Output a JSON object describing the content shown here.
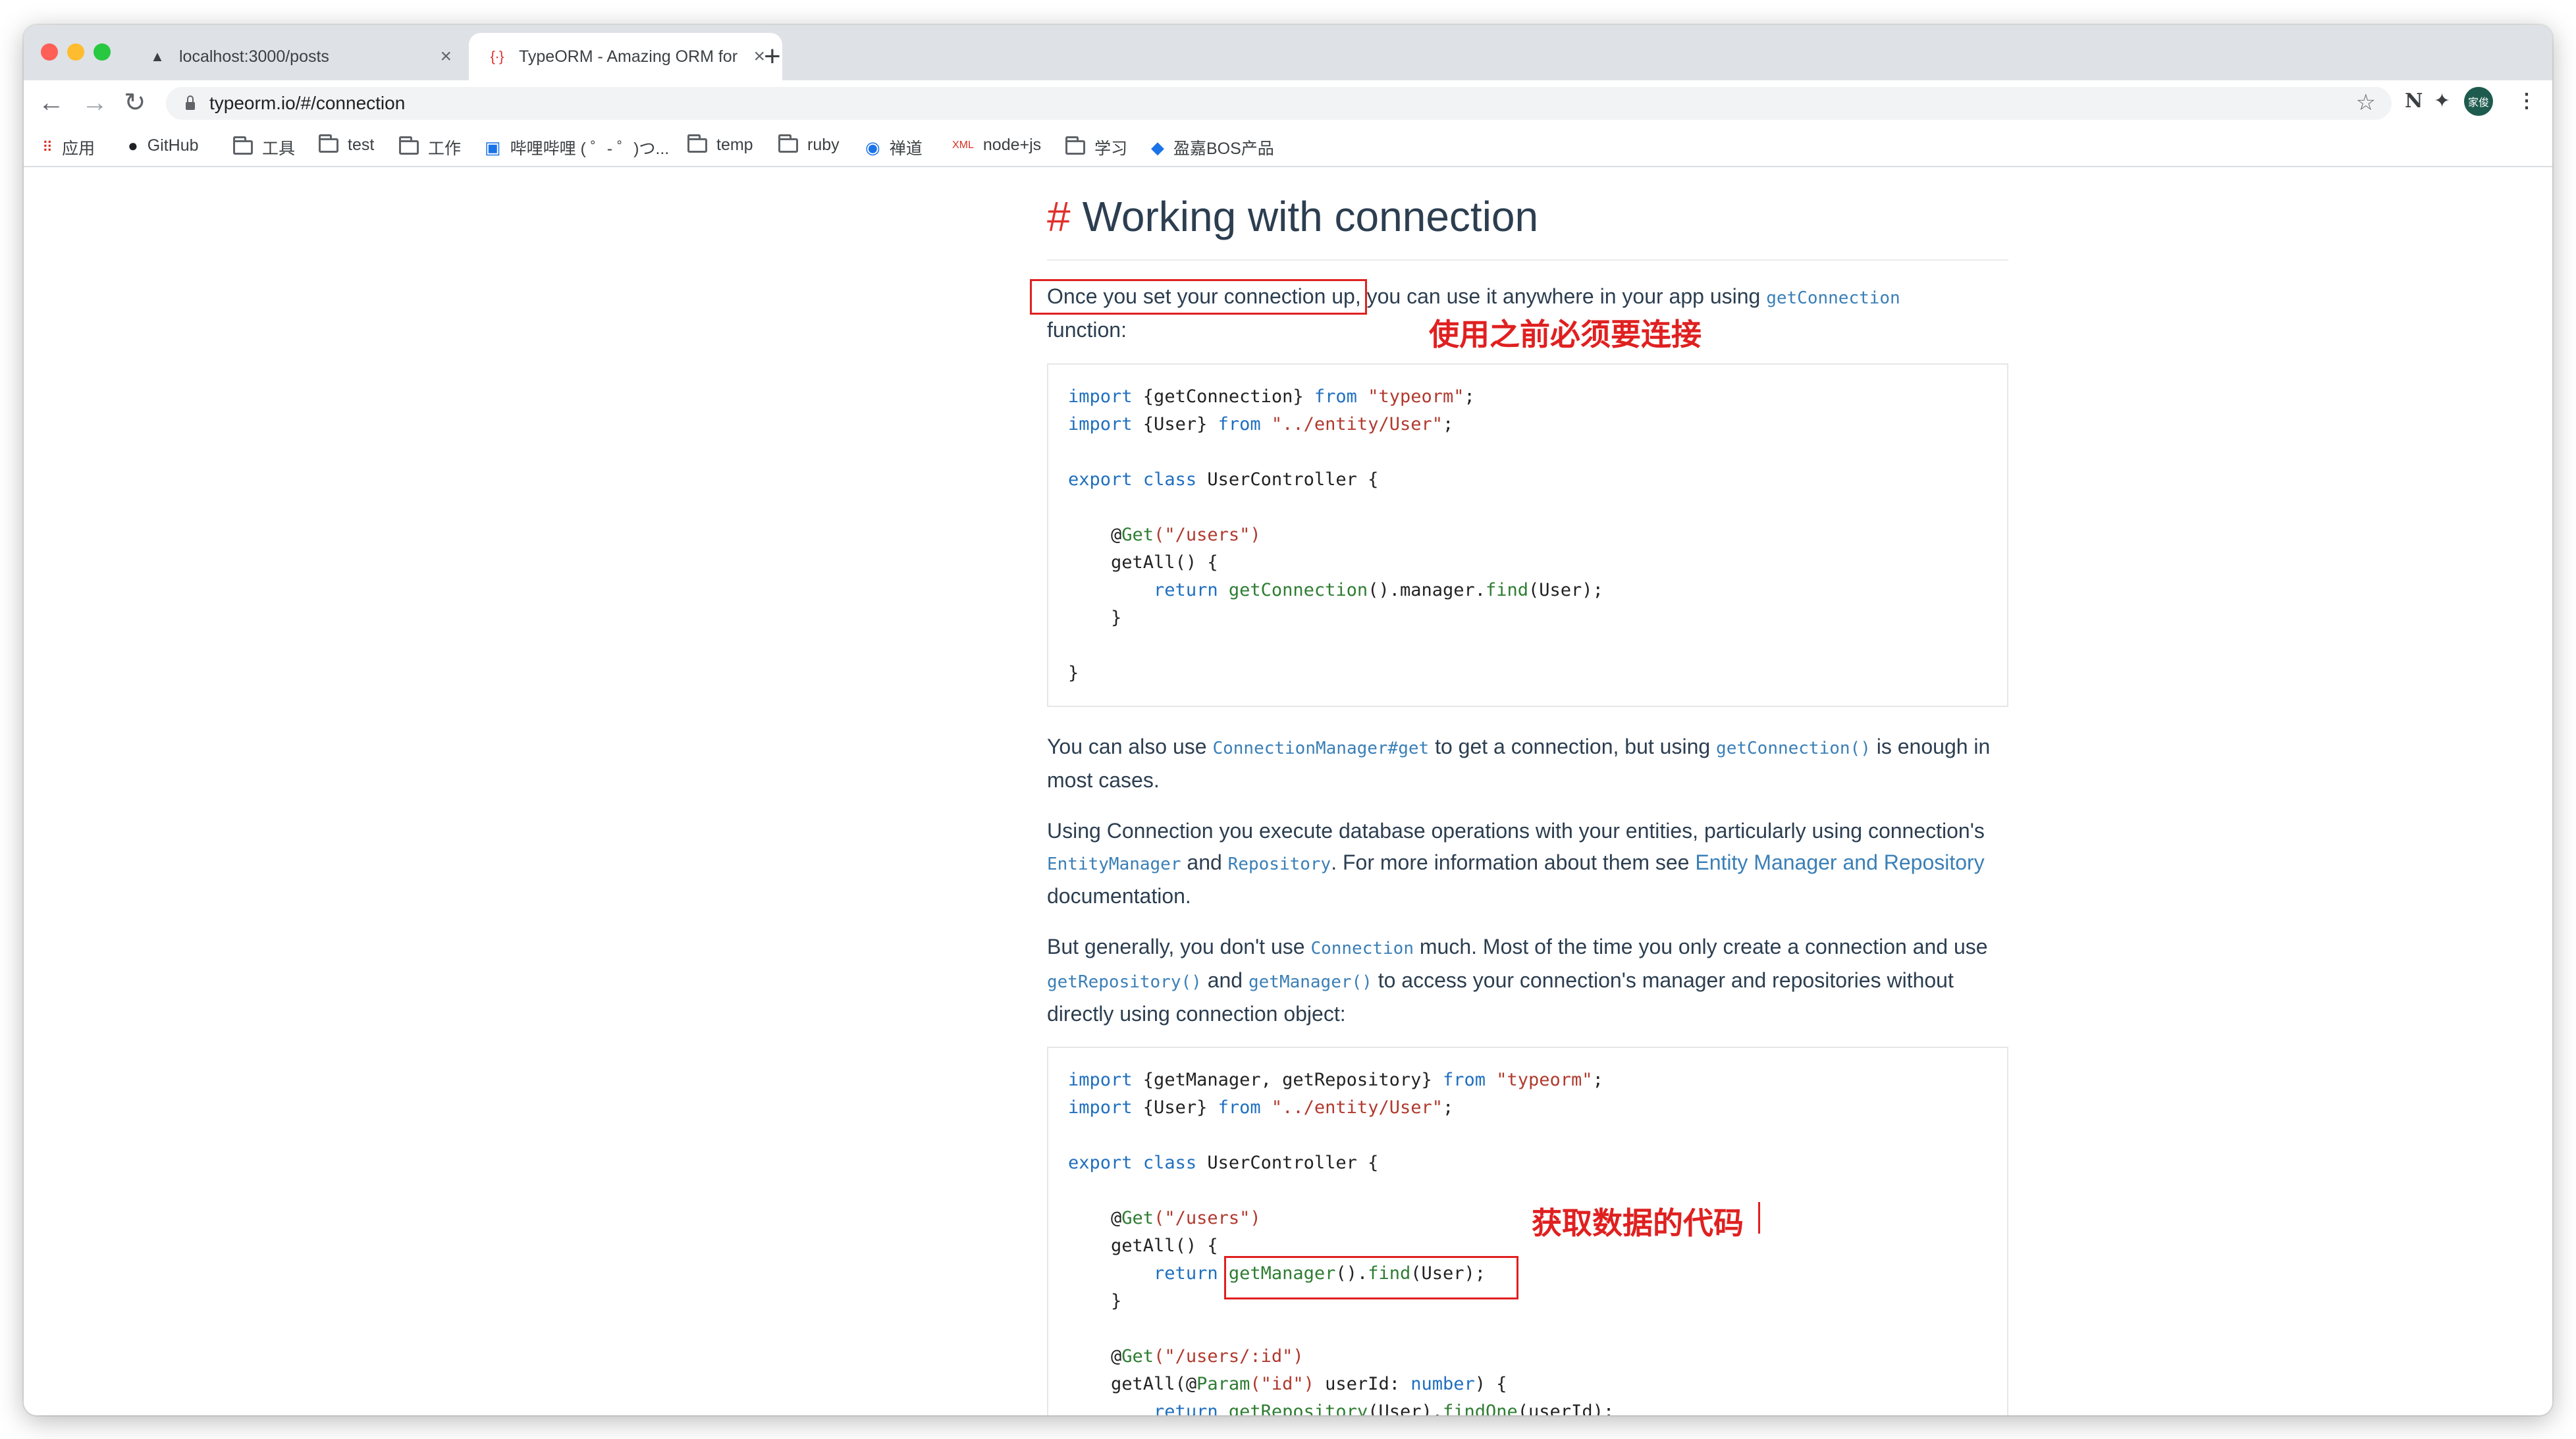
{
  "browser": {
    "tabs": [
      {
        "title": "localhost:3000/posts",
        "active": false
      },
      {
        "title": "TypeORM - Amazing ORM for",
        "active": true
      }
    ],
    "url": "typeorm.io/#/connection",
    "avatar_label": "家俊"
  },
  "bookmarks": [
    {
      "label": "应用",
      "icon": "apps-grid-icon"
    },
    {
      "label": "GitHub",
      "icon": "github-icon"
    },
    {
      "label": "工具",
      "icon": "folder-icon"
    },
    {
      "label": "test",
      "icon": "folder-icon"
    },
    {
      "label": "工作",
      "icon": "folder-icon"
    },
    {
      "label": "哔哩哔哩 ( ゜- ゜)つ...",
      "icon": "bilibili-icon"
    },
    {
      "label": "temp",
      "icon": "folder-icon"
    },
    {
      "label": "ruby",
      "icon": "folder-icon"
    },
    {
      "label": "禅道",
      "icon": "zentao-icon"
    },
    {
      "label": "node+js",
      "icon": "xml-icon"
    },
    {
      "label": "学习",
      "icon": "folder-icon"
    },
    {
      "label": "盈嘉BOS产品",
      "icon": "app-icon"
    }
  ],
  "page": {
    "heading_hash": "#",
    "heading": "Working with connection",
    "p1_boxed": "Once you set your connection up,",
    "p1_rest": " you can use it anywhere in your app using ",
    "p1_code": "getConnection",
    "p1_end": "function:",
    "code1": {
      "l1_kw": "import",
      "l1_mid": " {getConnection} ",
      "l1_from": "from",
      "l1_str": "\"typeorm\"",
      "l1_end": ";",
      "l2_kw": "import",
      "l2_mid": " {User} ",
      "l2_from": "from",
      "l2_str": "\"../entity/User\"",
      "l2_end": ";",
      "l3_kw1": "export",
      "l3_kw2": "class",
      "l3_rest": " UserController {",
      "l4_at": "@",
      "l4_fn": "Get",
      "l4_str": "(\"/users\")",
      "l5": "getAll() {",
      "l6_kw": "return",
      "l6_fn1": "getConnection",
      "l6_mid": "().manager.",
      "l6_fn2": "find",
      "l6_end": "(User);",
      "l7": "}",
      "l8": "}"
    },
    "p2_a": "You can also use ",
    "p2_code1": "ConnectionManager#get",
    "p2_b": " to get a connection, but using ",
    "p2_code2": "getConnection()",
    "p2_c": " is enough in most cases.",
    "p3_a": "Using Connection you execute database operations with your entities, particularly using connection's ",
    "p3_code1": "EntityManager",
    "p3_b": " and ",
    "p3_code2": "Repository",
    "p3_c": ". For more information about them see ",
    "p3_link": "Entity Manager and Repository",
    "p3_d": " documentation.",
    "p4_a": "But generally, you don't use ",
    "p4_code1": "Connection",
    "p4_b": " much. Most of the time you only create a connection and use ",
    "p4_code2": "getRepository()",
    "p4_c": " and ",
    "p4_code3": "getManager()",
    "p4_d": " to access your connection's manager and repositories without directly using connection object:",
    "code2": {
      "l1_kw": "import",
      "l1_mid": " {getManager, getRepository} ",
      "l1_from": "from",
      "l1_str": "\"typeorm\"",
      "l1_end": ";",
      "l2_kw": "import",
      "l2_mid": " {User} ",
      "l2_from": "from",
      "l2_str": "\"../entity/User\"",
      "l2_end": ";",
      "l3_kw1": "export",
      "l3_kw2": "class",
      "l3_rest": " UserController {",
      "l4_at": "@",
      "l4_fn": "Get",
      "l4_str": "(\"/users\")",
      "l5": "getAll() {",
      "l6_kw": "return",
      "l6_fn1": "getManager",
      "l6_mid": "().",
      "l6_fn2": "find",
      "l6_end": "(User);",
      "l7": "}",
      "l8_at": "@",
      "l8_fn": "Get",
      "l8_str": "(\"/users/:id\")",
      "l9_a": "getAll(@",
      "l9_fn": "Param",
      "l9_str": "(\"id\")",
      "l9_b": " userId: ",
      "l9_ty": "number",
      "l9_c": ") {",
      "l10_kw": "return",
      "l10_fn1": "getRepository",
      "l10_mid": "(User).",
      "l10_fn2": "findOne",
      "l10_end": "(userId);",
      "l11": "}"
    }
  },
  "annotations": {
    "note1": "使用之前必须要连接",
    "note2": "获取数据的代码"
  },
  "colors": {
    "annotation": "#e02020",
    "link": "#3a7fb7",
    "heading_hash": "#e0312e"
  }
}
